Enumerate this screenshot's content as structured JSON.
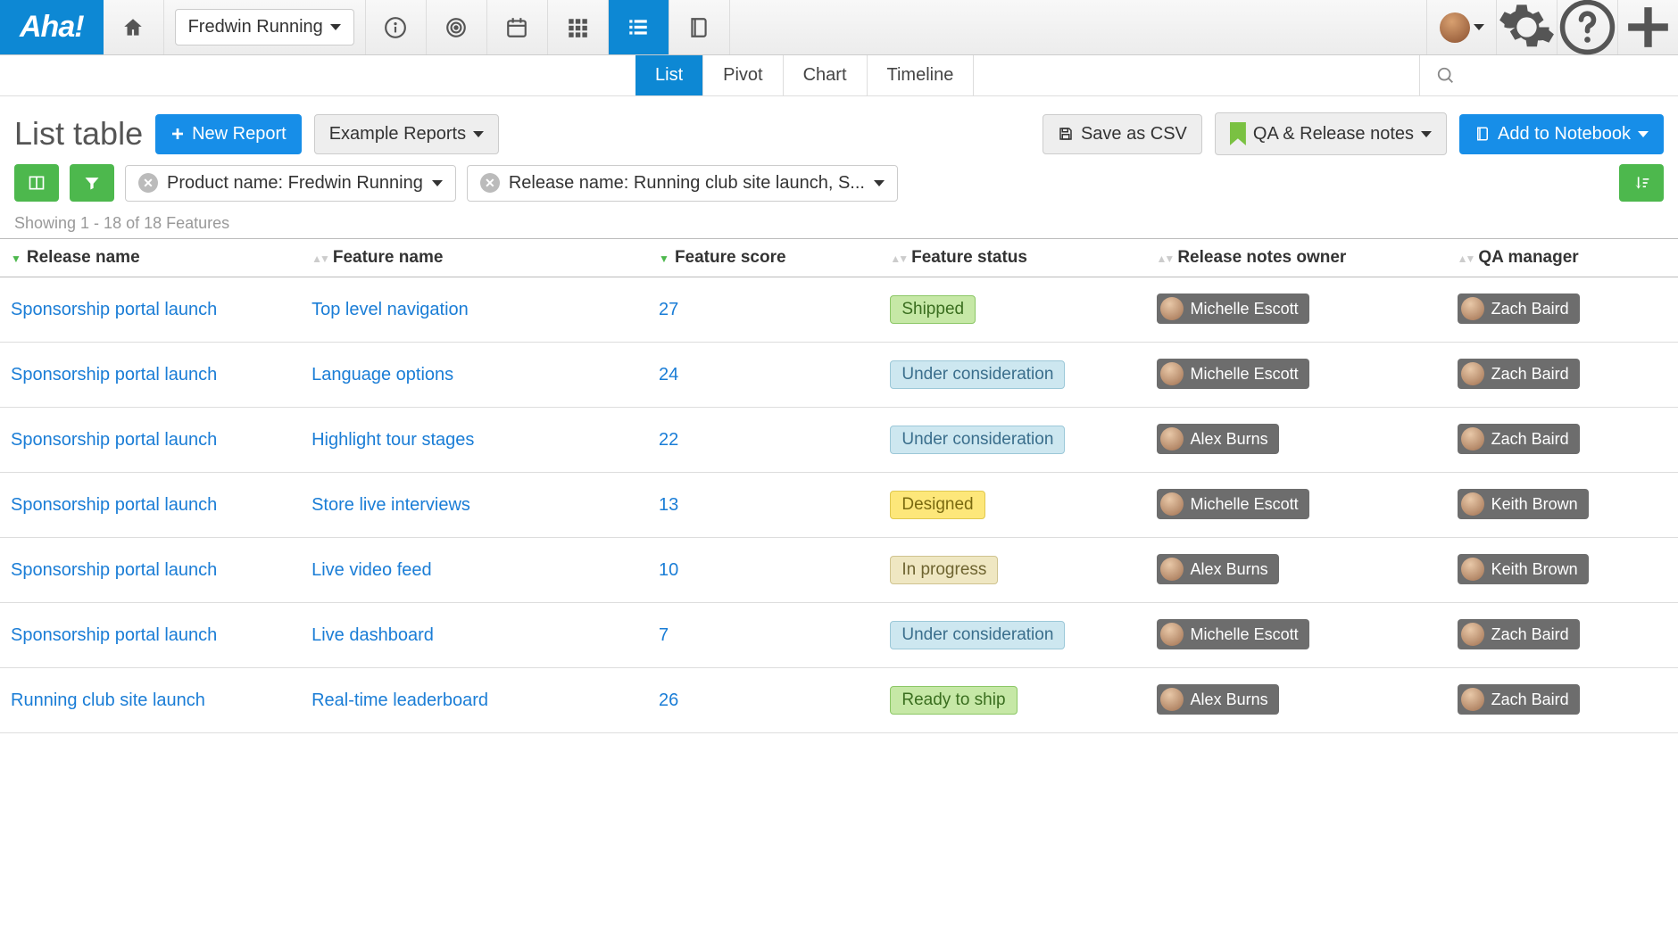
{
  "logo_text": "Aha!",
  "product_selector": "Fredwin Running",
  "subtabs": {
    "list": "List",
    "pivot": "Pivot",
    "chart": "Chart",
    "timeline": "Timeline"
  },
  "page_title": "List table",
  "buttons": {
    "new_report": "New Report",
    "example_reports": "Example Reports",
    "save_csv": "Save as CSV",
    "qa_notes": "QA & Release notes",
    "add_notebook": "Add to Notebook"
  },
  "filters": {
    "product": "Product name: Fredwin Running",
    "release": "Release name: Running club site launch, S..."
  },
  "showing_text": "Showing 1 - 18 of 18 Features",
  "columns": {
    "release": "Release name",
    "feature": "Feature name",
    "score": "Feature score",
    "status": "Feature status",
    "owner": "Release notes owner",
    "qa": "QA manager"
  },
  "status_styles": {
    "Shipped": {
      "bg": "#c6e8a6",
      "bd": "#8cc766",
      "fg": "#3a6e1f"
    },
    "Under consideration": {
      "bg": "#cde7f0",
      "bd": "#9cc8d8",
      "fg": "#3a6e8c"
    },
    "Designed": {
      "bg": "#fde77a",
      "bd": "#e0c850",
      "fg": "#7a6a10"
    },
    "In progress": {
      "bg": "#efe7c2",
      "bd": "#cfc390",
      "fg": "#6e6430"
    },
    "Ready to ship": {
      "bg": "#c6e8a6",
      "bd": "#8cc766",
      "fg": "#3a6e1f"
    }
  },
  "rows": [
    {
      "release": "Sponsorship portal launch",
      "feature": "Top level navigation",
      "score": "27",
      "status": "Shipped",
      "owner": "Michelle Escott",
      "qa": "Zach Baird"
    },
    {
      "release": "Sponsorship portal launch",
      "feature": "Language options",
      "score": "24",
      "status": "Under consideration",
      "owner": "Michelle Escott",
      "qa": "Zach Baird"
    },
    {
      "release": "Sponsorship portal launch",
      "feature": "Highlight tour stages",
      "score": "22",
      "status": "Under consideration",
      "owner": "Alex Burns",
      "qa": "Zach Baird"
    },
    {
      "release": "Sponsorship portal launch",
      "feature": "Store live interviews",
      "score": "13",
      "status": "Designed",
      "owner": "Michelle Escott",
      "qa": "Keith Brown"
    },
    {
      "release": "Sponsorship portal launch",
      "feature": "Live video feed",
      "score": "10",
      "status": "In progress",
      "owner": "Alex Burns",
      "qa": "Keith Brown"
    },
    {
      "release": "Sponsorship portal launch",
      "feature": "Live dashboard",
      "score": "7",
      "status": "Under consideration",
      "owner": "Michelle Escott",
      "qa": "Zach Baird"
    },
    {
      "release": "Running club site launch",
      "feature": "Real-time leaderboard",
      "score": "26",
      "status": "Ready to ship",
      "owner": "Alex Burns",
      "qa": "Zach Baird"
    }
  ]
}
